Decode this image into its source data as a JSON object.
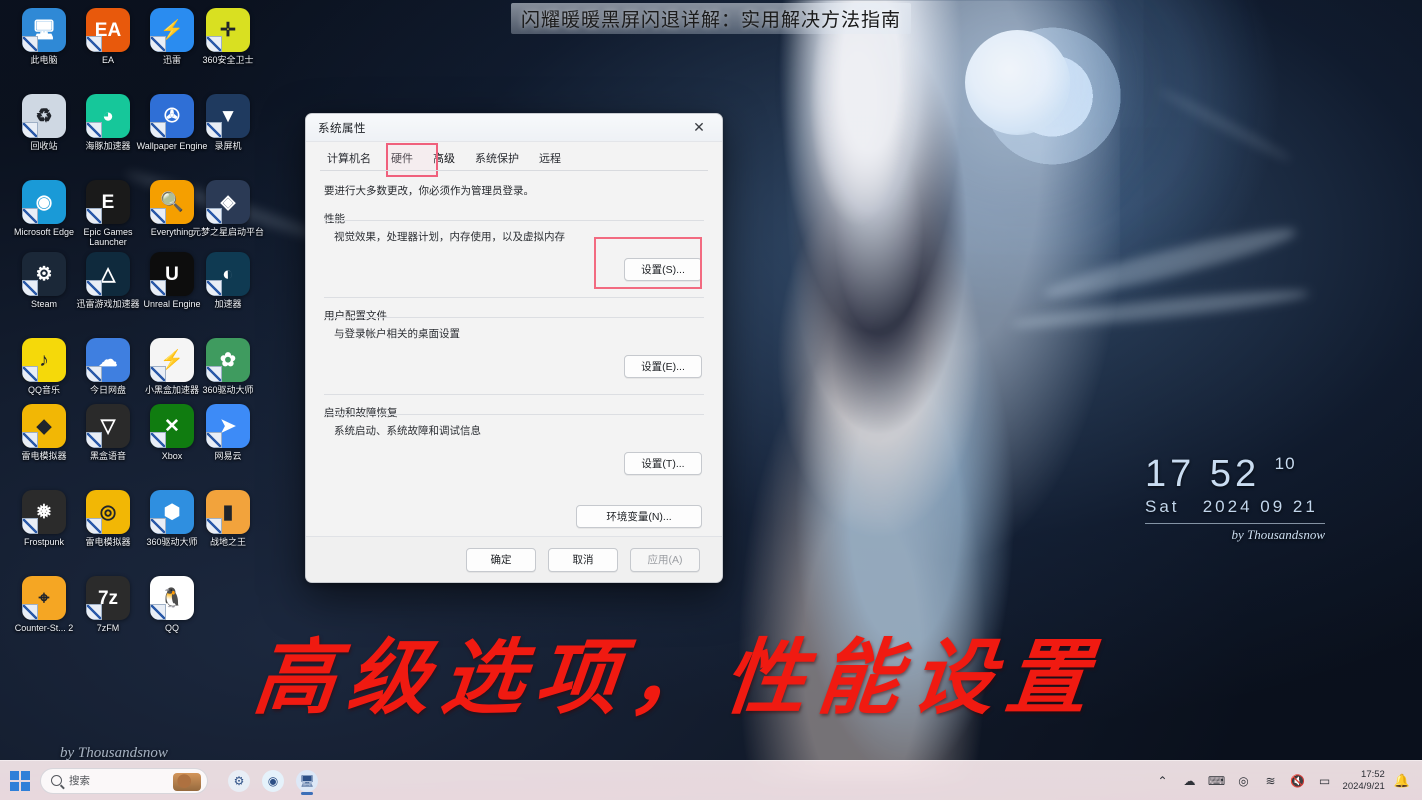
{
  "page": {
    "title": "闪耀暖暖黑屏闪退详解：实用解决方法指南",
    "overlay_annotation": "高级选项，性能设置",
    "accent_red": "#f01a11",
    "highlight_box_color": "#f26a80"
  },
  "desktop": {
    "signature": "by Thousandsnow",
    "clock_widget": {
      "hour_min": "17 52",
      "seconds": "10",
      "weekday": "Sat",
      "date": "2024 09 21",
      "credit": "by Thousandsnow"
    },
    "icons": [
      {
        "label": "此电脑",
        "glyph": "🖥",
        "color": "#2f89d6",
        "icon_name": "this-pc-icon"
      },
      {
        "label": "EA",
        "glyph": "EA",
        "color": "#e8590c",
        "icon_name": "ea-app-icon"
      },
      {
        "label": "迅雷",
        "glyph": "⚡",
        "color": "#2a8cf0",
        "icon_name": "thunder-download-icon"
      },
      {
        "label": "360安全卫士",
        "glyph": "✛",
        "color": "#d9e021",
        "icon_name": "360-safe-icon"
      },
      {
        "label": "回收站",
        "glyph": "♻",
        "color": "#cfd8e3",
        "icon_name": "recycle-bin-icon"
      },
      {
        "label": "海豚加速器",
        "glyph": "◕",
        "color": "#16c79a",
        "icon_name": "dolphin-accelerator-icon"
      },
      {
        "label": "Wallpaper Engine",
        "glyph": "✇",
        "color": "#2f6fd6",
        "icon_name": "wallpaper-engine-icon"
      },
      {
        "label": "录屏机",
        "glyph": "▼",
        "color": "#1f3a5f",
        "icon_name": "screen-recorder-icon"
      },
      {
        "label": "Microsoft Edge",
        "glyph": "◉",
        "color": "#1a9ad7",
        "icon_name": "microsoft-edge-icon"
      },
      {
        "label": "Epic Games Launcher",
        "glyph": "E",
        "color": "#1a1a1a",
        "icon_name": "epic-games-launcher-icon"
      },
      {
        "label": "Everything",
        "glyph": "🔍",
        "color": "#f59f00",
        "icon_name": "everything-search-icon"
      },
      {
        "label": "元梦之星启动平台",
        "glyph": "◈",
        "color": "#2b3a55",
        "icon_name": "dream-star-launcher-icon"
      },
      {
        "label": "Steam",
        "glyph": "⚙",
        "color": "#1b2838",
        "icon_name": "steam-icon"
      },
      {
        "label": "迅雷游戏加速器",
        "glyph": "△",
        "color": "#0f2a3d",
        "icon_name": "thunder-game-booster-icon"
      },
      {
        "label": "Unreal Engine",
        "glyph": "U",
        "color": "#0d0d0d",
        "icon_name": "unreal-engine-icon"
      },
      {
        "label": "加速器",
        "glyph": "◐",
        "color": "#0f3a52",
        "icon_name": "network-accelerator-icon"
      },
      {
        "label": "QQ音乐",
        "glyph": "♪",
        "color": "#f5d90a",
        "icon_name": "qq-music-icon"
      },
      {
        "label": "今日网盘",
        "glyph": "☁",
        "color": "#3f7fe0",
        "icon_name": "cloud-drive-icon"
      },
      {
        "label": "小黑盒加速器",
        "glyph": "⚡",
        "color": "#f5f5f5",
        "icon_name": "heybox-accelerator-icon"
      },
      {
        "label": "360驱动大师",
        "glyph": "✿",
        "color": "#3f9b5f",
        "icon_name": "360-driver-master-icon"
      },
      {
        "label": "雷电模拟器",
        "glyph": "◆",
        "color": "#f2b705",
        "icon_name": "ldplayer-emulator-icon"
      },
      {
        "label": "黑盒语音",
        "glyph": "▽",
        "color": "#2a2a2a",
        "icon_name": "voice-chat-icon"
      },
      {
        "label": "Xbox",
        "glyph": "✕",
        "color": "#107c10",
        "icon_name": "xbox-icon"
      },
      {
        "label": "网易云",
        "glyph": "➤",
        "color": "#3d8bf7",
        "icon_name": "netease-icon"
      },
      {
        "label": "Frostpunk",
        "glyph": "❅",
        "color": "#2b2b2b",
        "icon_name": "frostpunk-game-icon"
      },
      {
        "label": "雷电模拟器",
        "glyph": "◎",
        "color": "#f2b705",
        "icon_name": "ldplayer-emulator-icon-2"
      },
      {
        "label": "360驱动大师",
        "glyph": "⬢",
        "color": "#2f8fe0",
        "icon_name": "360-driver-master-icon-2"
      },
      {
        "label": "战地之王",
        "glyph": "▮",
        "color": "#f2a33c",
        "icon_name": "battlefield-game-icon"
      },
      {
        "label": "Counter-St... 2",
        "glyph": "⌖",
        "color": "#f5a623",
        "icon_name": "counter-strike-2-icon"
      },
      {
        "label": "7zFM",
        "glyph": "7z",
        "color": "#2b2b2b",
        "icon_name": "7zip-file-manager-icon"
      },
      {
        "label": "QQ",
        "glyph": "🐧",
        "color": "#ffffff",
        "icon_name": "qq-icon"
      }
    ]
  },
  "system_properties_dialog": {
    "title": "系统属性",
    "close_label": "✕",
    "tabs": [
      {
        "label": "计算机名",
        "selected": false
      },
      {
        "label": "硬件",
        "selected": false
      },
      {
        "label": "高级",
        "selected": true
      },
      {
        "label": "系统保护",
        "selected": false
      },
      {
        "label": "远程",
        "selected": false
      }
    ],
    "admin_note": "要进行大多数更改，你必须作为管理员登录。",
    "sections": [
      {
        "title": "性能",
        "description": "视觉效果，处理器计划，内存使用，以及虚拟内存",
        "button": "设置(S)...",
        "highlighted": true
      },
      {
        "title": "用户配置文件",
        "description": "与登录帐户相关的桌面设置",
        "button": "设置(E)...",
        "highlighted": false
      },
      {
        "title": "启动和故障恢复",
        "description": "系统启动、系统故障和调试信息",
        "button": "设置(T)...",
        "highlighted": false
      }
    ],
    "env_button": "环境变量(N)...",
    "footer": {
      "ok": "确定",
      "cancel": "取消",
      "apply": "应用(A)",
      "apply_disabled": true
    }
  },
  "taskbar": {
    "start_label": "开始",
    "search_placeholder": "搜索",
    "apps": [
      {
        "label": "Steam",
        "glyph": "⚙",
        "color": "#e8eef6",
        "active": false,
        "icon_name": "taskbar-steam-icon"
      },
      {
        "label": "Microsoft Edge",
        "glyph": "◉",
        "color": "#e5f2fb",
        "active": false,
        "icon_name": "taskbar-edge-icon"
      },
      {
        "label": "系统属性",
        "glyph": "🖥",
        "color": "#dde8f7",
        "active": true,
        "icon_name": "taskbar-system-properties-icon"
      }
    ],
    "tray": [
      {
        "glyph": "⌃",
        "icon_name": "show-hidden-icons-chevron"
      },
      {
        "glyph": "☁",
        "icon_name": "onedrive-icon"
      },
      {
        "glyph": "⌨",
        "icon_name": "ime-icon"
      },
      {
        "glyph": "◎",
        "icon_name": "antivirus-icon"
      },
      {
        "glyph": "≋",
        "icon_name": "wifi-icon"
      },
      {
        "glyph": "🔇",
        "icon_name": "volume-muted-icon"
      },
      {
        "glyph": "▭",
        "icon_name": "battery-icon"
      }
    ],
    "clock": {
      "time": "17:52",
      "date": "2024/9/21"
    },
    "notification_glyph": "🔔"
  }
}
